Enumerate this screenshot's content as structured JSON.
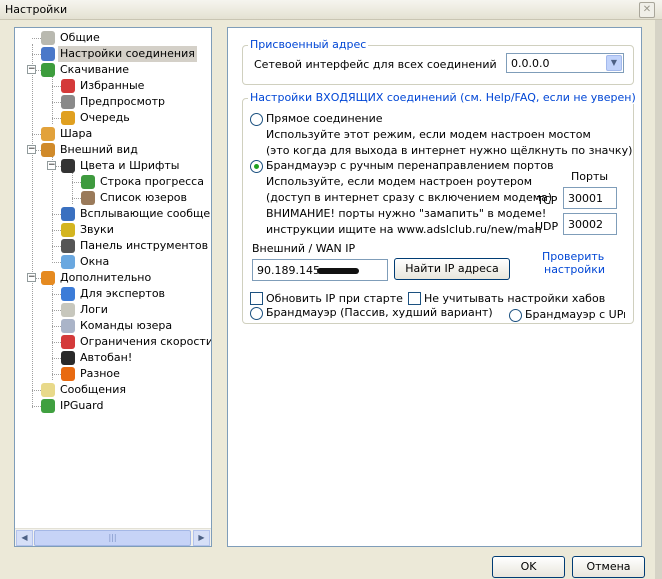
{
  "window": {
    "title": "Настройки"
  },
  "tree": {
    "items": [
      {
        "label": "Общие",
        "icon": "gear-icon"
      },
      {
        "label": "Настройки соединения",
        "icon": "network-icon"
      },
      {
        "label": "Скачивание",
        "icon": "download-icon"
      },
      {
        "label": "Избранные",
        "icon": "heart-icon"
      },
      {
        "label": "Предпросмотр",
        "icon": "preview-icon"
      },
      {
        "label": "Очередь",
        "icon": "queue-icon"
      },
      {
        "label": "Шара",
        "icon": "share-icon"
      },
      {
        "label": "Внешний вид",
        "icon": "appearance-icon"
      },
      {
        "label": "Цвета и Шрифты",
        "icon": "palette-icon"
      },
      {
        "label": "Строка прогресса",
        "icon": "progress-icon"
      },
      {
        "label": "Список юзеров",
        "icon": "users-icon"
      },
      {
        "label": "Всплывающие сообщения",
        "icon": "popup-icon"
      },
      {
        "label": "Звуки",
        "icon": "sound-icon"
      },
      {
        "label": "Панель инструментов",
        "icon": "toolbar-icon"
      },
      {
        "label": "Окна",
        "icon": "window-icon"
      },
      {
        "label": "Дополнительно",
        "icon": "advanced-icon"
      },
      {
        "label": "Для экспертов",
        "icon": "expert-icon"
      },
      {
        "label": "Логи",
        "icon": "log-icon"
      },
      {
        "label": "Команды юзера",
        "icon": "commands-icon"
      },
      {
        "label": "Ограничения скорости",
        "icon": "speed-limit-icon"
      },
      {
        "label": "Автобан!",
        "icon": "ban-icon"
      },
      {
        "label": "Разное",
        "icon": "misc-icon"
      },
      {
        "label": "Сообщения",
        "icon": "messages-icon"
      },
      {
        "label": "IPGuard",
        "icon": "ipguard-icon"
      }
    ],
    "scroll_grip": "|||"
  },
  "assigned": {
    "legend": "Присвоенный адрес",
    "interface_label": "Сетевой интерфейс для всех соединений",
    "interface_value": "0.0.0.0"
  },
  "incoming": {
    "legend": "Настройки ВХОДЯЩИХ соединений (см. Help/FAQ, если не уверен)",
    "direct_label": "Прямое соединение",
    "direct_desc1": "Используйте этот режим, если модем настроен мостом",
    "direct_desc2": "(это когда для выхода в интернет нужно щёлкнуть по значку)",
    "firewall_label": "Брандмауэр с ручным перенаправлением портов",
    "firewall_desc1": "Используйте, если модем настроен роутером",
    "firewall_desc2": "(доступ в интернет сразу с включением модема)",
    "firewall_desc3": "ВНИМАНИЕ! порты нужно \"замапить\" в модеме!",
    "firewall_desc4": "инструкции ищите на www.adslclub.ru/new/man",
    "ports_label": "Порты",
    "tcp_label": "TCP",
    "tcp_value": "30001",
    "udp_label": "UDP",
    "udp_value": "30002",
    "wan_label": "Внешний / WAN IP",
    "wan_value": "90.189.145.",
    "find_ip_button": "Найти IP адреса",
    "check_settings_line1": "Проверить",
    "check_settings_line2": "настройки",
    "update_ip_label": "Обновить IP при старте",
    "ignore_hubs_label": "Не учитывать настройки хабов",
    "passive_label": "Брандмауэр (Пассив, худший вариант)",
    "upnp_label": "Брандмауэр с UPnP ("
  },
  "buttons": {
    "ok": "OK",
    "cancel": "Отмена"
  },
  "colors": {
    "accent": "#0046d5",
    "selection": "#d4d0c8",
    "border": "#7f9db9"
  }
}
